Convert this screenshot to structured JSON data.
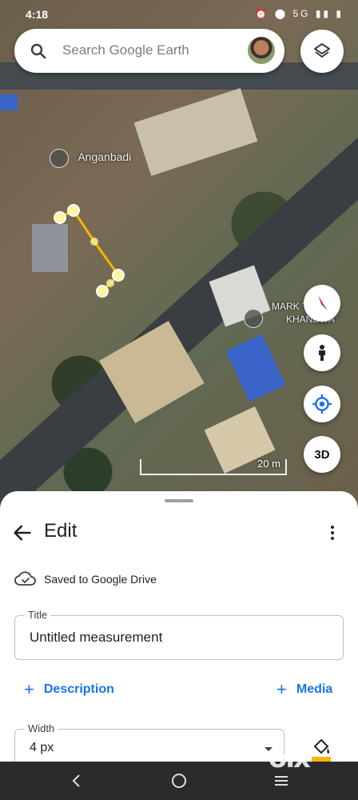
{
  "status_bar": {
    "time": "4:18",
    "network": "5G"
  },
  "search": {
    "placeholder": "Search Google Earth"
  },
  "map": {
    "labels": [
      {
        "text": "Anganbadi"
      },
      {
        "text": "MARK     TFIC"
      },
      {
        "text": "KHANDWA"
      }
    ],
    "scale_label": "20 m"
  },
  "buttons": {
    "three_d": "3D"
  },
  "sheet": {
    "heading": "Edit",
    "saved_text": "Saved to Google Drive",
    "title_field": {
      "label": "Title",
      "value": "Untitled measurement"
    },
    "description_label": "Description",
    "media_label": "Media",
    "width_field": {
      "label": "Width",
      "value": "4 px"
    }
  },
  "watermark": "olx",
  "colors": {
    "accent": "#1a73e8",
    "measure_line": "#f4b400"
  },
  "icons": [
    "search-icon",
    "layers-icon",
    "compass-icon",
    "street-view-icon",
    "my-location-icon",
    "back-arrow-icon",
    "more-vert-icon",
    "cloud-done-icon",
    "fill-color-icon"
  ]
}
